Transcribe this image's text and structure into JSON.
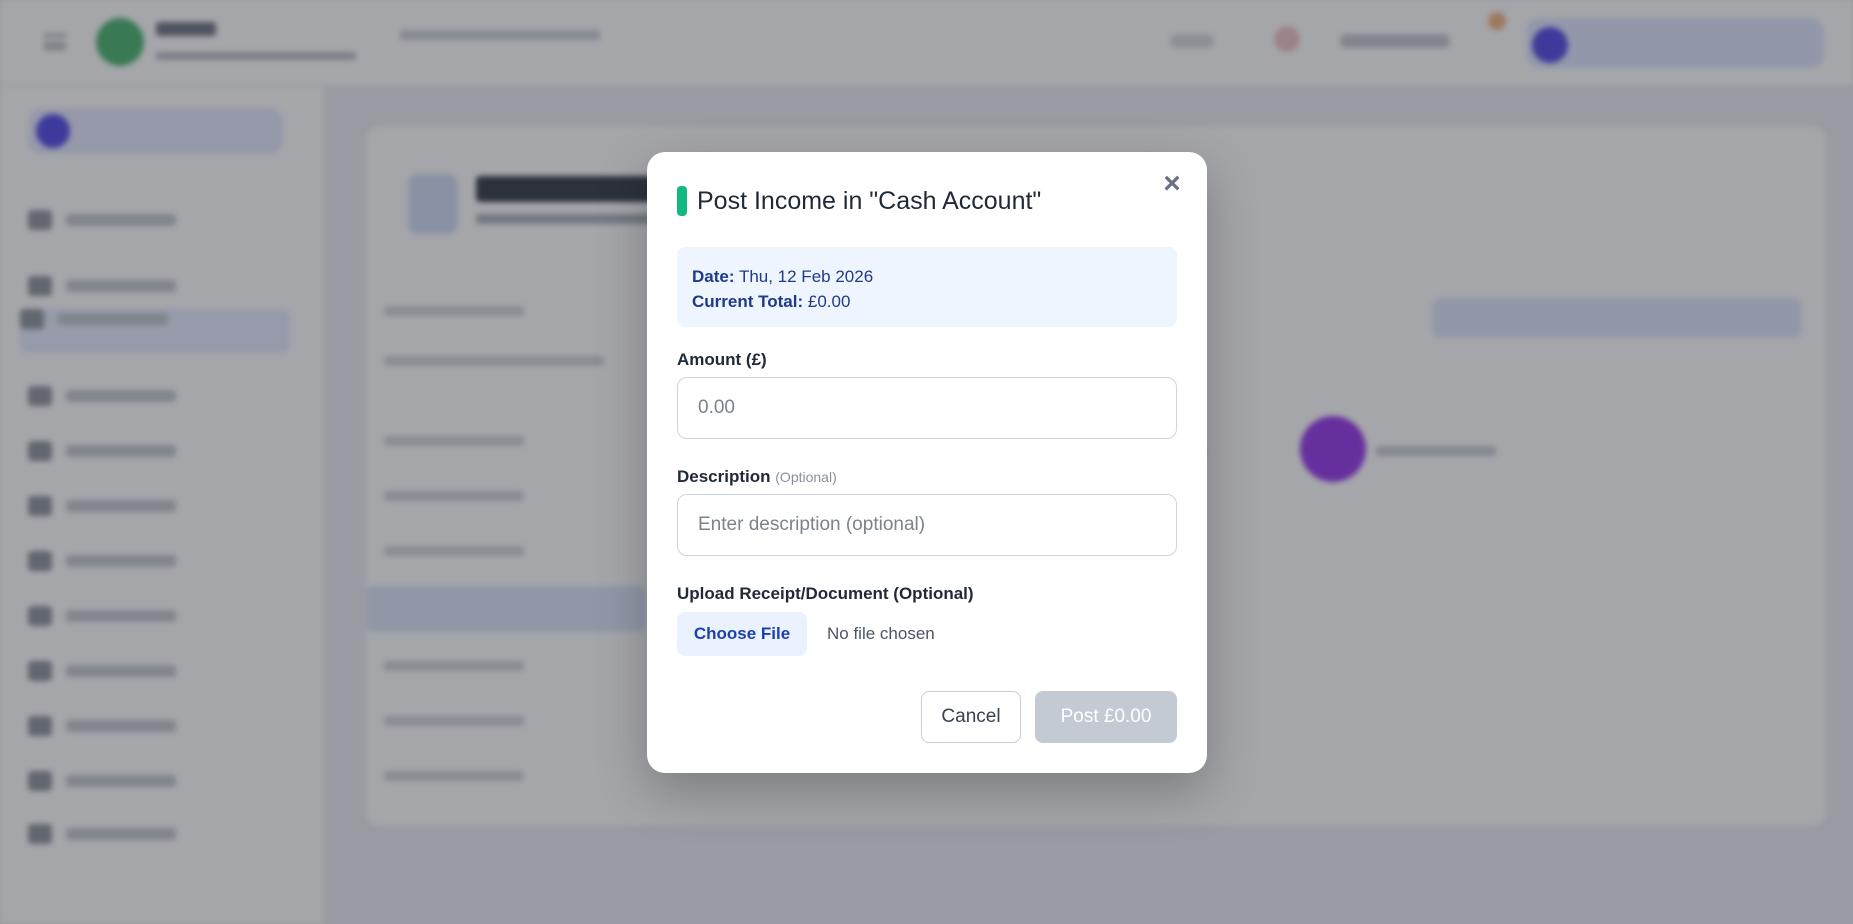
{
  "modal": {
    "title": "Post Income in \"Cash Account\"",
    "accent_color": "#10b981",
    "close_icon": "close-icon",
    "info": {
      "date_label": "Date:",
      "date_value": "Thu, 12 Feb 2026",
      "total_label": "Current Total:",
      "total_value": "£0.00"
    },
    "amount": {
      "label": "Amount (£)",
      "placeholder": "0.00",
      "value": ""
    },
    "description": {
      "label": "Description",
      "optional_tag": "(Optional)",
      "placeholder": "Enter description (optional)",
      "value": ""
    },
    "upload": {
      "label": "Upload Receipt/Document (Optional)",
      "button_label": "Choose File",
      "status": "No file chosen"
    },
    "actions": {
      "cancel_label": "Cancel",
      "post_label": "Post £0.00"
    }
  }
}
